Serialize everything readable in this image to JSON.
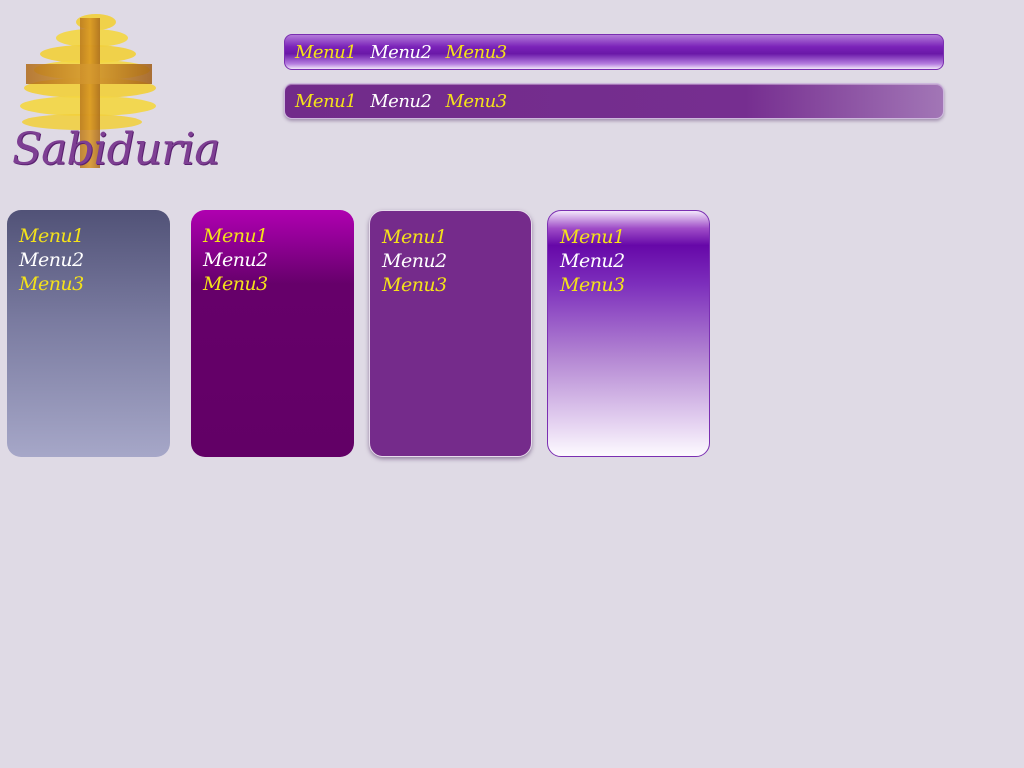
{
  "logo": {
    "text": "Sabiduria",
    "icon": "tree-icon"
  },
  "colors": {
    "background": "#dfdae5",
    "accent_yellow": "#f4e21a",
    "accent_white": "#ffffff",
    "logo_text": "#7e3f93",
    "bar1": "#6a18a8",
    "bar2": "#762e90",
    "panel1": "#7a7ba0",
    "panel2": "#620066",
    "panel3": "#752b8b",
    "panel4": "#6608a8"
  },
  "horizontal_menus": [
    {
      "items": [
        {
          "label": "Menu1",
          "color": "yellow"
        },
        {
          "label": "Menu2",
          "color": "white"
        },
        {
          "label": "Menu3",
          "color": "yellow"
        }
      ]
    },
    {
      "items": [
        {
          "label": "Menu1",
          "color": "yellow"
        },
        {
          "label": "Menu2",
          "color": "white"
        },
        {
          "label": "Menu3",
          "color": "yellow"
        }
      ]
    }
  ],
  "vertical_menus": [
    {
      "items": [
        {
          "label": "Menu1",
          "color": "yellow"
        },
        {
          "label": "Menu2",
          "color": "white"
        },
        {
          "label": "Menu3",
          "color": "yellow"
        }
      ]
    },
    {
      "items": [
        {
          "label": "Menu1",
          "color": "yellow"
        },
        {
          "label": "Menu2",
          "color": "white"
        },
        {
          "label": "Menu3",
          "color": "yellow"
        }
      ]
    },
    {
      "items": [
        {
          "label": "Menu1",
          "color": "yellow"
        },
        {
          "label": "Menu2",
          "color": "white"
        },
        {
          "label": "Menu3",
          "color": "yellow"
        }
      ]
    },
    {
      "items": [
        {
          "label": "Menu1",
          "color": "yellow"
        },
        {
          "label": "Menu2",
          "color": "white"
        },
        {
          "label": "Menu3",
          "color": "yellow"
        }
      ]
    }
  ]
}
